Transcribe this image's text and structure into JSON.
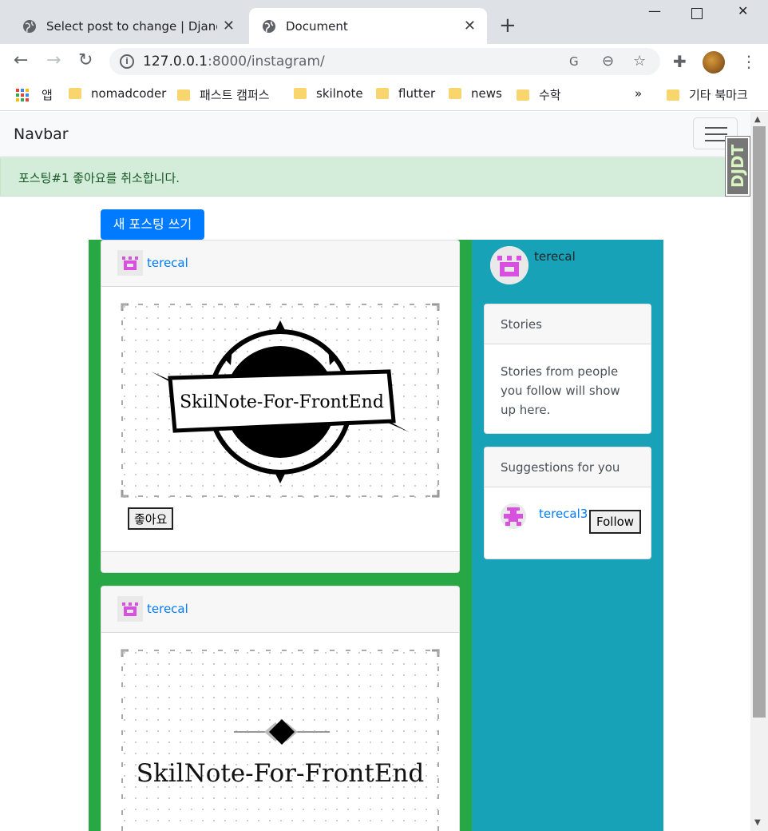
{
  "browser": {
    "tabs": [
      {
        "title": "Select post to change | Django",
        "active": false
      },
      {
        "title": "Document",
        "active": true
      }
    ],
    "url_host": "127.0.0.1",
    "url_rest": ":8000/instagram/",
    "bookmarks": {
      "apps": "앱",
      "items": [
        "nomadcoder",
        "패스트 캠퍼스",
        "skilnote",
        "flutter",
        "news",
        "수학"
      ],
      "overflow": "»",
      "other": "기타 북마크"
    }
  },
  "navbar": {
    "brand": "Navbar"
  },
  "alert": {
    "message": "포스팅#1 좋아요를 취소합니다."
  },
  "djdt": {
    "label": "DJDT"
  },
  "new_post_button": "새 포스팅 쓰기",
  "posts": [
    {
      "author": "terecal",
      "image_text": "SkilNote-For-FrontEnd",
      "like_label": "좋아요"
    },
    {
      "author": "terecal",
      "image_text": "SkilNote-For-FrontEnd"
    }
  ],
  "sidebar": {
    "username": "terecal",
    "stories": {
      "title": "Stories",
      "body": "Stories from people you follow will show up here."
    },
    "suggestions": {
      "title": "Suggestions for you",
      "user": "terecal3",
      "follow_label": "Follow"
    }
  },
  "colors": {
    "left_column": "#28a745",
    "right_column": "#17a2b8",
    "primary": "#007bff",
    "alert_bg": "#d4edda"
  }
}
